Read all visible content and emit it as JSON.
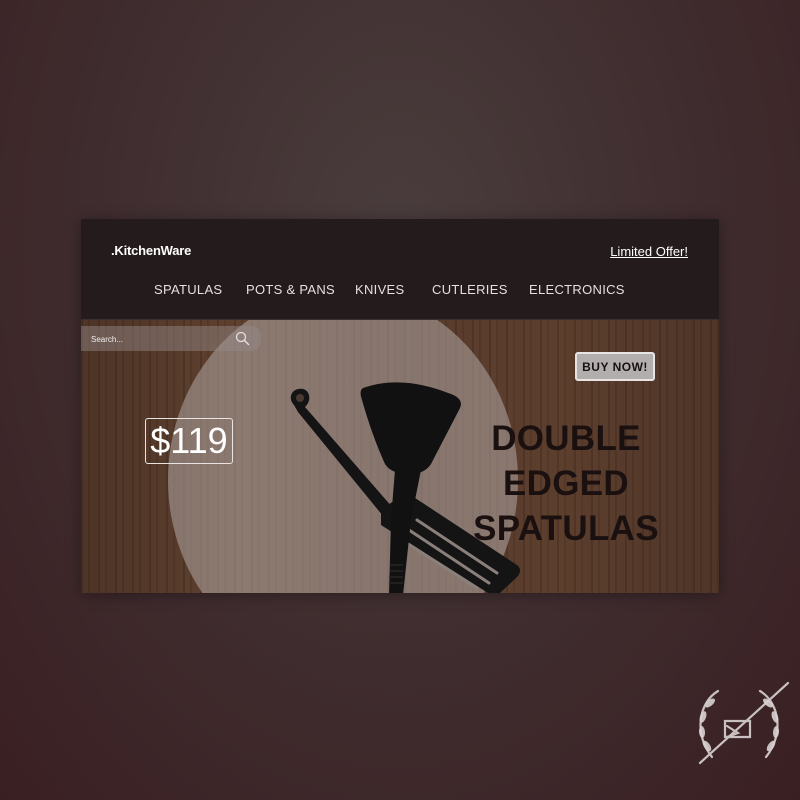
{
  "header": {
    "brand": ".KitchenWare",
    "offer_link": "Limited Offer!"
  },
  "nav": {
    "items": [
      {
        "label": "SPATULAS"
      },
      {
        "label": "POTS & PANS"
      },
      {
        "label": "KNIVES"
      },
      {
        "label": "CUTLERIES"
      },
      {
        "label": "ELECTRONICS"
      }
    ]
  },
  "search": {
    "placeholder": "Search...",
    "icon": "search-icon"
  },
  "hero": {
    "buy_button": "BUY NOW!",
    "price": "$119",
    "title_lines": [
      "DOUBLE",
      "EDGED",
      "SPATULAS"
    ],
    "image": "black-spatulas"
  },
  "colors": {
    "page_background": "#3f2c2e",
    "header_background": "#241b1c",
    "wood": "#553829",
    "title_text": "#1b1010",
    "button_background": "#b3aeae"
  }
}
